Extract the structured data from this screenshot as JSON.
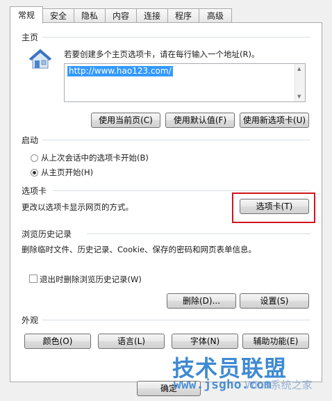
{
  "tabs": [
    "常规",
    "安全",
    "隐私",
    "内容",
    "连接",
    "程序",
    "高级"
  ],
  "home": {
    "section_title": "主页",
    "instruction": "若要创建多个主页选项卡，请在每行输入一个地址(R)。",
    "url": "http://www.hao123.com/",
    "btn_current": "使用当前页(C)",
    "btn_default": "使用默认值(F)",
    "btn_newtab": "使用新选项卡(U)"
  },
  "startup": {
    "section_title": "启动",
    "option_last": "从上次会话中的选项卡开始(B)",
    "option_home": "从主页开始(H)"
  },
  "tabs_section": {
    "section_title": "选项卡",
    "description": "更改以选项卡显示网页的方式。",
    "btn": "选项卡(T)"
  },
  "history": {
    "section_title": "浏览历史记录",
    "description": "删除临时文件、历史记录、Cookie、保存的密码和网页表单信息。",
    "checkbox_label": "退出时删除浏览历史记录(W)",
    "btn_delete": "删除(D)...",
    "btn_settings": "设置(S)"
  },
  "appearance": {
    "section_title": "外观",
    "btn_colors": "颜色(O)",
    "btn_languages": "语言(L)",
    "btn_fonts": "字体(N)",
    "btn_accessibility": "辅助功能(E)"
  },
  "footer": {
    "ok_label": "确定"
  },
  "watermark": {
    "brand": "技术员联盟",
    "site": "www.jsgho.com",
    "tag": "Win8系统之家"
  },
  "colors": {
    "highlight": "#d1131d",
    "selection": "#3399ff"
  }
}
